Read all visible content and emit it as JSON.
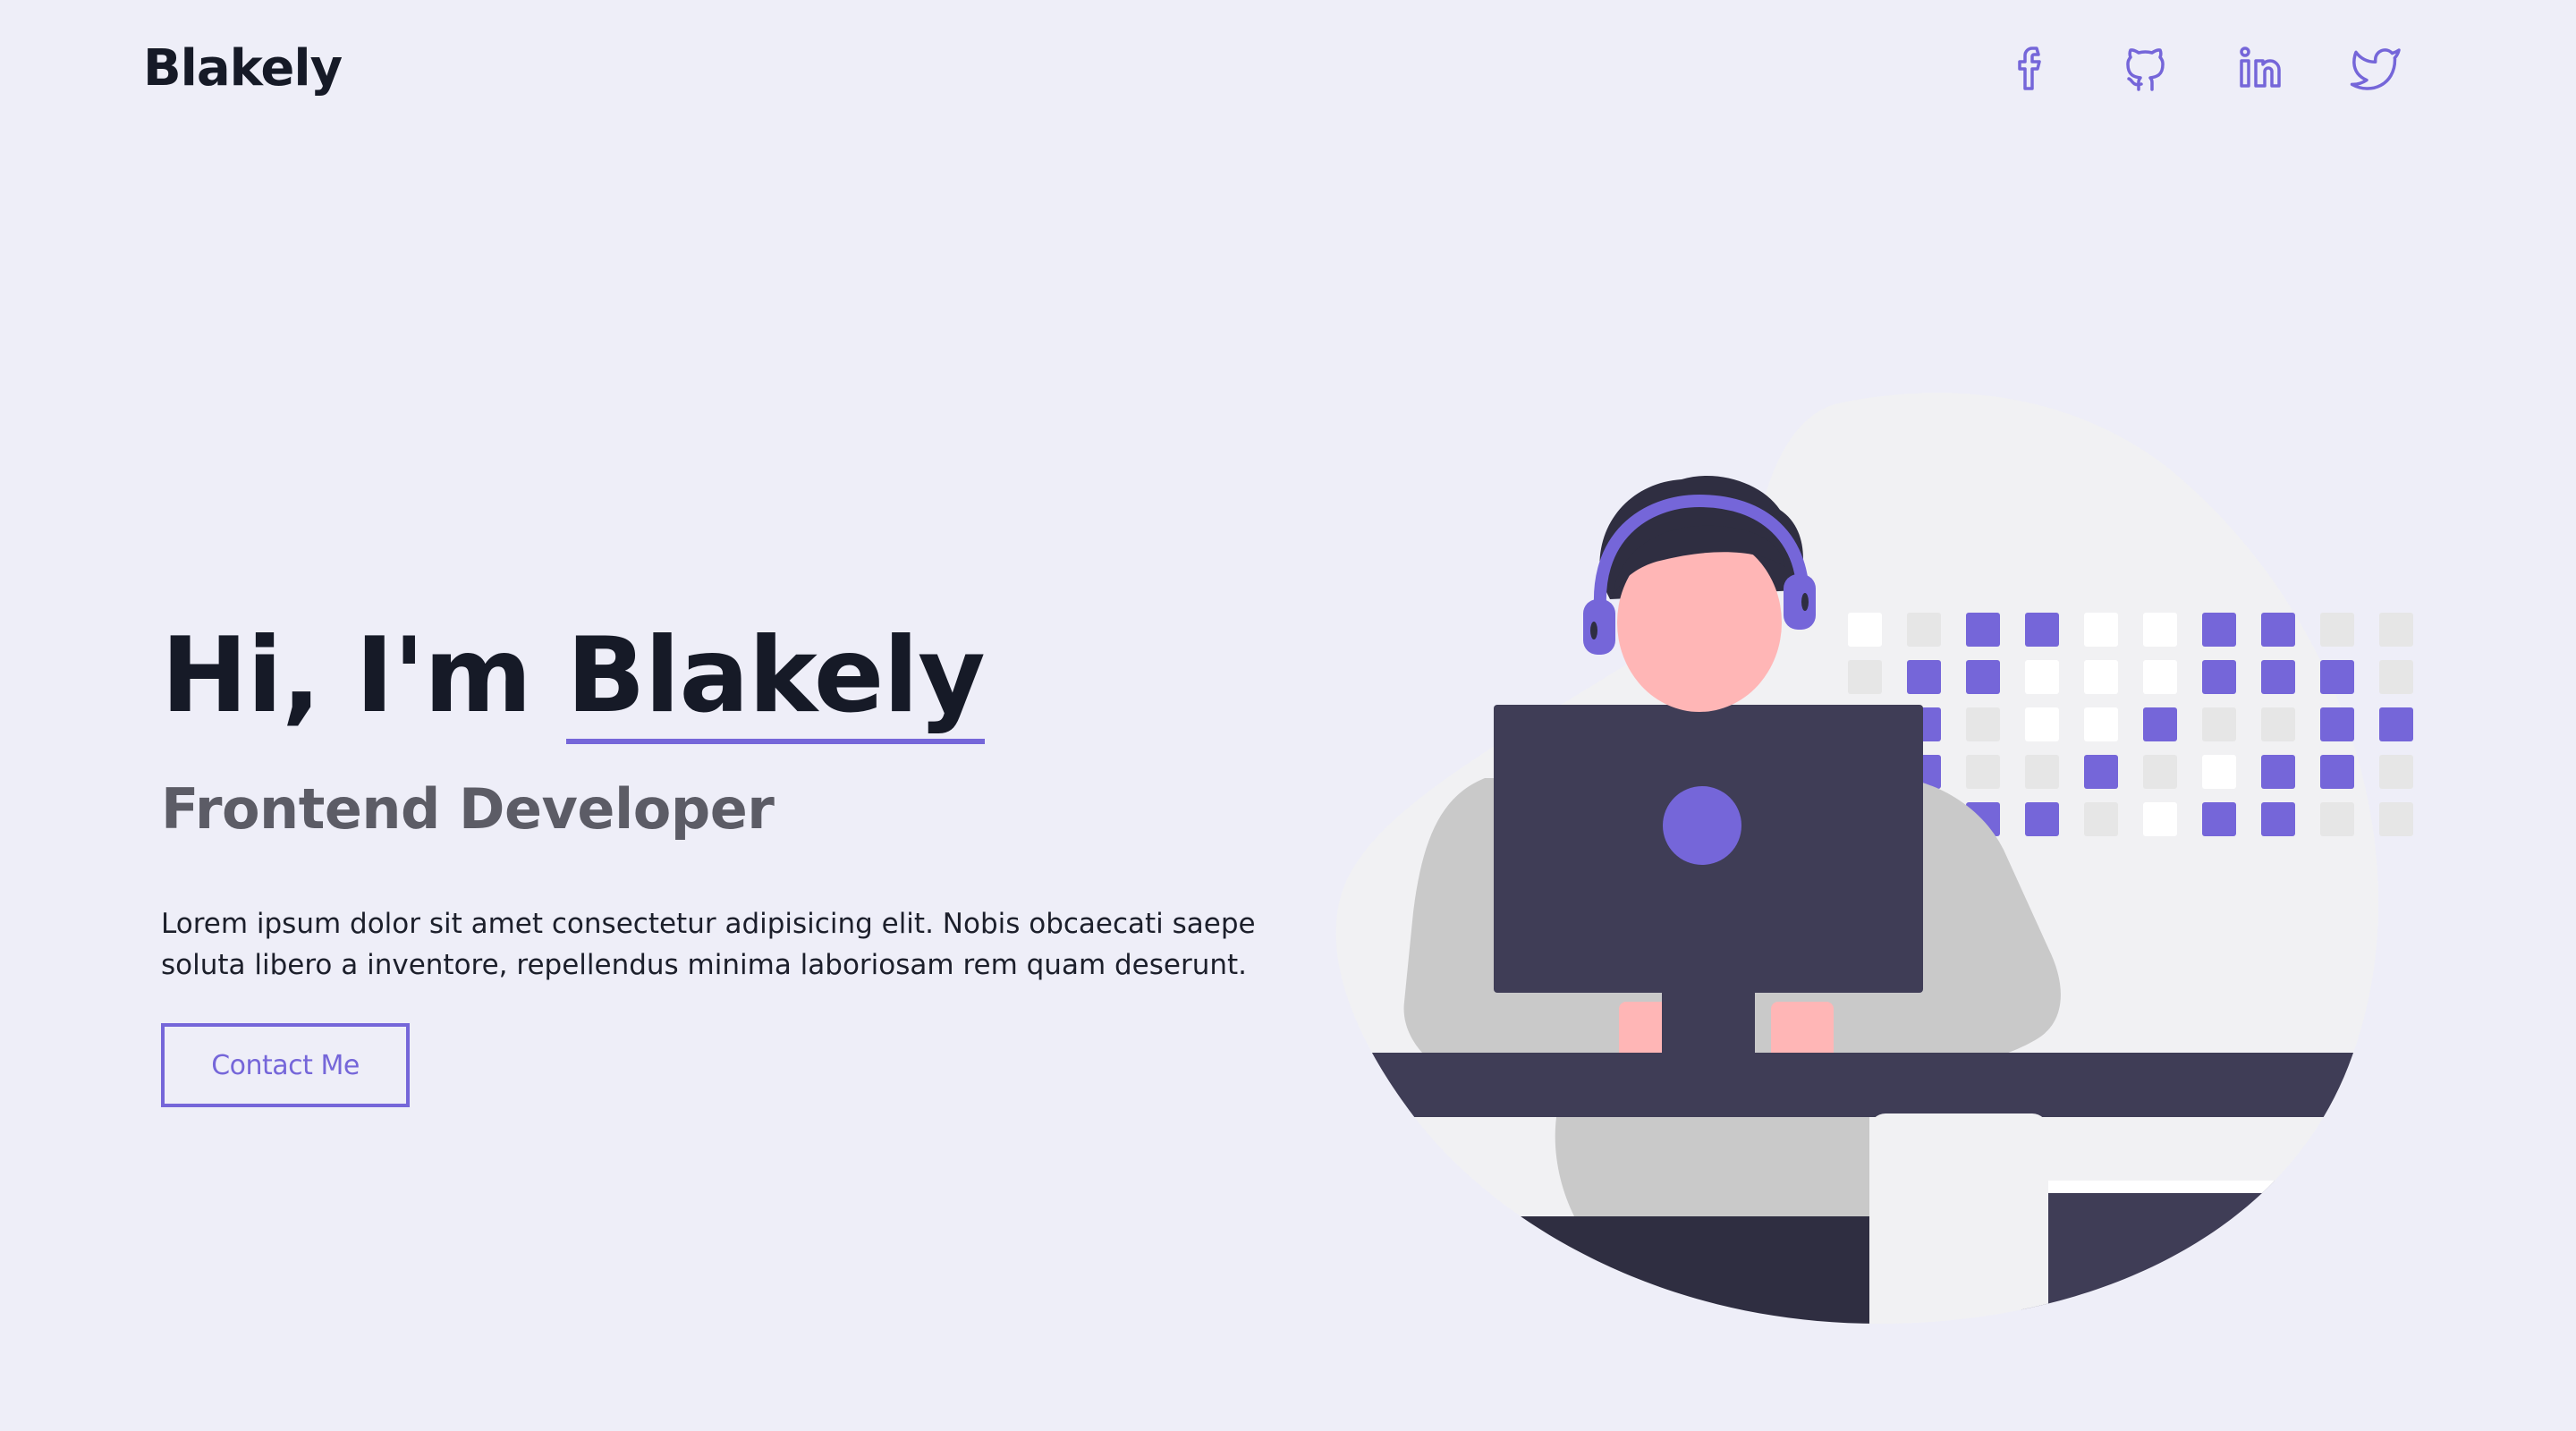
{
  "header": {
    "logo": "Blakely",
    "socials": [
      {
        "name": "facebook",
        "icon": "facebook-icon"
      },
      {
        "name": "github",
        "icon": "github-icon"
      },
      {
        "name": "linkedin",
        "icon": "linkedin-icon"
      },
      {
        "name": "twitter",
        "icon": "twitter-icon"
      }
    ]
  },
  "hero": {
    "greeting": "Hi, I'm ",
    "name": "Blakely",
    "role": "Frontend Developer",
    "description": "Lorem ipsum dolor sit amet consectetur adipisicing elit. Nobis obcaecati saepe soluta libero a inventore, repellendus minima laboriosam rem quam deserunt.",
    "cta_label": "Contact Me"
  },
  "colors": {
    "accent": "#7566d9",
    "background": "#eeeef8",
    "text_dark": "#161a27",
    "text_muted": "#5c5c66"
  }
}
